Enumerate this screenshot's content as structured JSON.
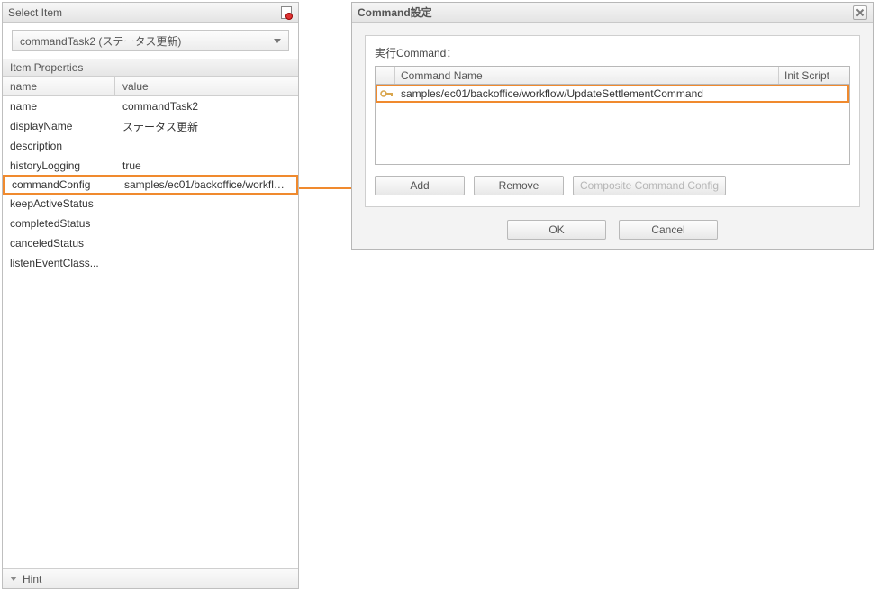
{
  "leftPanel": {
    "title": "Select Item",
    "dropdownValue": "commandTask2 (ステータス更新)",
    "propsHeader": "Item Properties",
    "colName": "name",
    "colValue": "value",
    "rows": [
      {
        "name": "name",
        "value": "commandTask2"
      },
      {
        "name": "displayName",
        "value": "ステータス更新"
      },
      {
        "name": "description",
        "value": ""
      },
      {
        "name": "historyLogging",
        "value": "true"
      },
      {
        "name": "commandConfig",
        "value": "samples/ec01/backoffice/workflow/Update..."
      },
      {
        "name": "keepActiveStatus",
        "value": ""
      },
      {
        "name": "completedStatus",
        "value": ""
      },
      {
        "name": "canceledStatus",
        "value": ""
      },
      {
        "name": "listenEventClass...",
        "value": ""
      }
    ],
    "hint": "Hint"
  },
  "dialog": {
    "title": "Command設定",
    "execLabel": "実行Command：",
    "colCommand": "Command Name",
    "colInit": "Init Script",
    "rowCommand": "samples/ec01/backoffice/workflow/UpdateSettlementCommand",
    "btnAdd": "Add",
    "btnRemove": "Remove",
    "btnComposite": "Composite Command Config",
    "btnOK": "OK",
    "btnCancel": "Cancel"
  }
}
